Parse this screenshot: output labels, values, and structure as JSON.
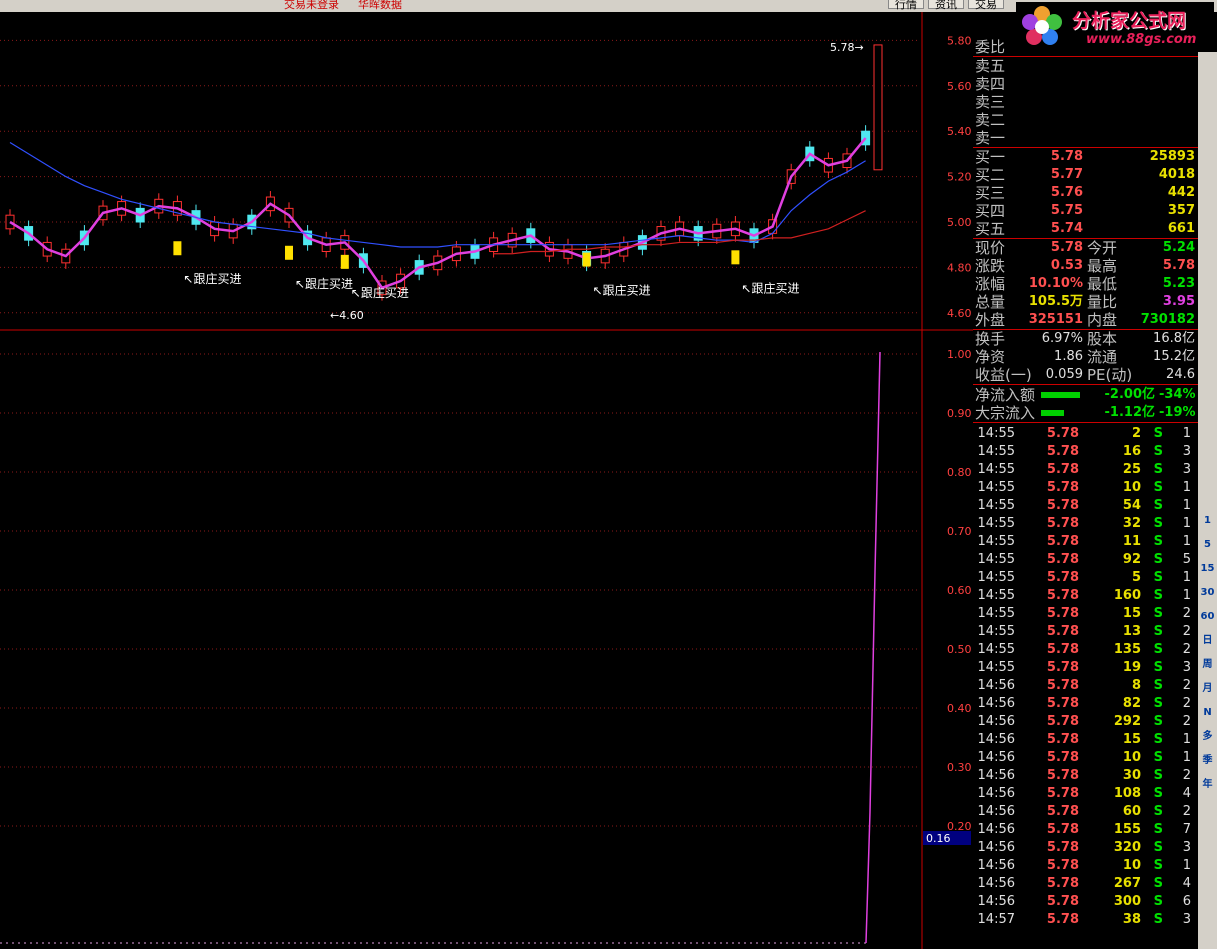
{
  "topbar": {
    "status_text": "交易未登录",
    "status_text2": "华晖数据",
    "buttons": [
      "行情",
      "资讯",
      "交易"
    ]
  },
  "brand": {
    "title": "分析家公式网",
    "url": "www.88gs.com"
  },
  "chart": {
    "price_axis": [
      "5.80",
      "5.60",
      "5.40",
      "5.20",
      "5.00",
      "4.80",
      "4.60"
    ],
    "indicator_axis": [
      "1.00",
      "0.90",
      "0.80",
      "0.70",
      "0.60",
      "0.50",
      "0.40",
      "0.30",
      "0.20"
    ],
    "indicator_current": "0.16",
    "high_label": "5.78",
    "low_label": "4.60",
    "signal_label": "跟庄买进",
    "colors": {
      "up": "#ff3030",
      "down": "#50e8f0",
      "signal": "#ffe000",
      "ma5": "#e040e0",
      "ma20": "#3050ff",
      "ma60": "#d02020",
      "grid": "#8b1a1a"
    }
  },
  "chart_data": {
    "type": "line",
    "title": "",
    "xlabel": "",
    "ylabel": "",
    "ylim": [
      4.5,
      5.85
    ],
    "series": [
      {
        "values": [
          5.0,
          4.95,
          4.88,
          4.85,
          4.93,
          5.04,
          5.06,
          5.03,
          5.07,
          5.06,
          5.02,
          4.97,
          4.96,
          5.0,
          5.08,
          5.03,
          4.93,
          4.9,
          4.91,
          4.83,
          4.71,
          4.74,
          4.8,
          4.82,
          4.86,
          4.87,
          4.9,
          4.92,
          4.94,
          4.88,
          4.87,
          4.84,
          4.85,
          4.88,
          4.91,
          4.95,
          4.97,
          4.95,
          4.96,
          4.97,
          4.94,
          4.98,
          5.2,
          5.3,
          5.25,
          5.27,
          5.37
        ]
      },
      {
        "values": [
          5.35,
          5.3,
          5.25,
          5.2,
          5.16,
          5.13,
          5.1,
          5.08,
          5.06,
          5.04,
          5.02,
          5.0,
          4.99,
          4.98,
          4.97,
          4.96,
          4.95,
          4.93,
          4.92,
          4.91,
          4.9,
          4.89,
          4.89,
          4.89,
          4.9,
          4.9,
          4.9,
          4.9,
          4.9,
          4.9,
          4.9,
          4.9,
          4.9,
          4.91,
          4.92,
          4.93,
          4.94,
          4.93,
          4.92,
          4.92,
          4.91,
          4.95,
          5.05,
          5.12,
          5.18,
          5.22,
          5.27
        ]
      },
      {
        "values": [
          4.86,
          4.86,
          4.87,
          4.87,
          4.88,
          4.88,
          4.89,
          4.89,
          4.9,
          4.9,
          4.91,
          4.91,
          4.91,
          4.92,
          4.92,
          4.93,
          4.93,
          4.95,
          4.97,
          5.01,
          5.05
        ]
      }
    ]
  },
  "quote": {
    "weibi_label": "委比",
    "sell": [
      {
        "label": "卖五",
        "price": "",
        "vol": ""
      },
      {
        "label": "卖四",
        "price": "",
        "vol": ""
      },
      {
        "label": "卖三",
        "price": "",
        "vol": ""
      },
      {
        "label": "卖二",
        "price": "",
        "vol": ""
      },
      {
        "label": "卖一",
        "price": "",
        "vol": ""
      }
    ],
    "buy": [
      {
        "label": "买一",
        "price": "5.78",
        "vol": "25893"
      },
      {
        "label": "买二",
        "price": "5.77",
        "vol": "4018"
      },
      {
        "label": "买三",
        "price": "5.76",
        "vol": "442"
      },
      {
        "label": "买四",
        "price": "5.75",
        "vol": "357"
      },
      {
        "label": "买五",
        "price": "5.74",
        "vol": "661"
      }
    ],
    "stats": [
      {
        "l1": "现价",
        "v1": "5.78",
        "c1": "r",
        "l2": "今开",
        "v2": "5.24",
        "c2": "g"
      },
      {
        "l1": "涨跌",
        "v1": "0.53",
        "c1": "r",
        "l2": "最高",
        "v2": "5.78",
        "c2": "r"
      },
      {
        "l1": "涨幅",
        "v1": "10.10%",
        "c1": "r",
        "l2": "最低",
        "v2": "5.23",
        "c2": "g"
      },
      {
        "l1": "总量",
        "v1": "105.5万",
        "c1": "y",
        "l2": "量比",
        "v2": "3.95",
        "c2": "m"
      },
      {
        "l1": "外盘",
        "v1": "325151",
        "c1": "r",
        "l2": "内盘",
        "v2": "730182",
        "c2": "g"
      }
    ],
    "fund": [
      {
        "l1": "换手",
        "v1": "6.97%",
        "l2": "股本",
        "v2": "16.8亿"
      },
      {
        "l1": "净资",
        "v1": "1.86",
        "l2": "流通",
        "v2": "15.2亿"
      },
      {
        "l1": "收益(一)",
        "v1": "0.059",
        "l2": "PE(动)",
        "v2": "24.6"
      }
    ],
    "flow": [
      {
        "label": "净流入额",
        "value": "-2.00亿",
        "pct": "-34%",
        "bar": 0.85
      },
      {
        "label": "大宗流入",
        "value": "-1.12亿",
        "pct": "-19%",
        "bar": 0.5
      }
    ],
    "ticks": [
      [
        "14:55",
        "5.78",
        "2",
        "S",
        "1"
      ],
      [
        "14:55",
        "5.78",
        "16",
        "S",
        "3"
      ],
      [
        "14:55",
        "5.78",
        "25",
        "S",
        "3"
      ],
      [
        "14:55",
        "5.78",
        "10",
        "S",
        "1"
      ],
      [
        "14:55",
        "5.78",
        "54",
        "S",
        "1"
      ],
      [
        "14:55",
        "5.78",
        "32",
        "S",
        "1"
      ],
      [
        "14:55",
        "5.78",
        "11",
        "S",
        "1"
      ],
      [
        "14:55",
        "5.78",
        "92",
        "S",
        "5"
      ],
      [
        "14:55",
        "5.78",
        "5",
        "S",
        "1"
      ],
      [
        "14:55",
        "5.78",
        "160",
        "S",
        "1"
      ],
      [
        "14:55",
        "5.78",
        "15",
        "S",
        "2"
      ],
      [
        "14:55",
        "5.78",
        "13",
        "S",
        "2"
      ],
      [
        "14:55",
        "5.78",
        "135",
        "S",
        "2"
      ],
      [
        "14:55",
        "5.78",
        "19",
        "S",
        "3"
      ],
      [
        "14:56",
        "5.78",
        "8",
        "S",
        "2"
      ],
      [
        "14:56",
        "5.78",
        "82",
        "S",
        "2"
      ],
      [
        "14:56",
        "5.78",
        "292",
        "S",
        "2"
      ],
      [
        "14:56",
        "5.78",
        "15",
        "S",
        "1"
      ],
      [
        "14:56",
        "5.78",
        "10",
        "S",
        "1"
      ],
      [
        "14:56",
        "5.78",
        "30",
        "S",
        "2"
      ],
      [
        "14:56",
        "5.78",
        "108",
        "S",
        "4"
      ],
      [
        "14:56",
        "5.78",
        "60",
        "S",
        "2"
      ],
      [
        "14:56",
        "5.78",
        "155",
        "S",
        "7"
      ],
      [
        "14:56",
        "5.78",
        "320",
        "S",
        "3"
      ],
      [
        "14:56",
        "5.78",
        "10",
        "S",
        "1"
      ],
      [
        "14:56",
        "5.78",
        "267",
        "S",
        "4"
      ],
      [
        "14:56",
        "5.78",
        "300",
        "S",
        "6"
      ],
      [
        "14:57",
        "5.78",
        "38",
        "S",
        "3"
      ]
    ]
  },
  "tools": [
    "1",
    "5",
    "15",
    "30",
    "60",
    "日",
    "周",
    "月",
    "N",
    "多",
    "季",
    "年"
  ]
}
